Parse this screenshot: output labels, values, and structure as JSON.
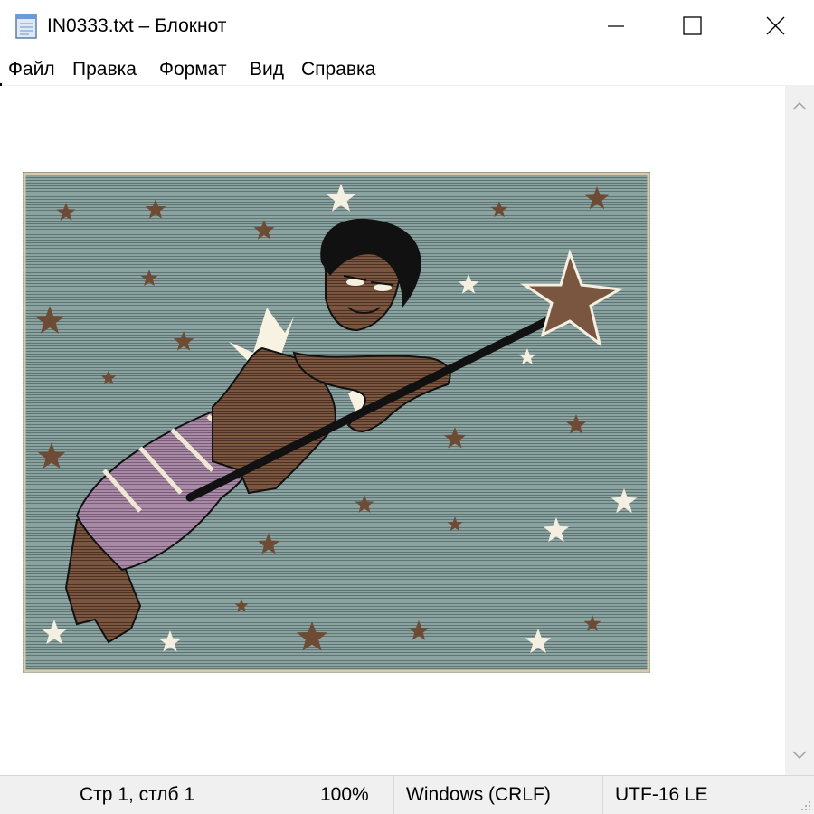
{
  "window": {
    "title": "IN0333.txt – Блокнот",
    "icon": "notepad-icon",
    "controls": [
      "minimize-icon",
      "maximize-icon",
      "close-icon"
    ]
  },
  "menu": {
    "items": [
      {
        "label": "Файл"
      },
      {
        "label": "Правка"
      },
      {
        "label": "Формат"
      },
      {
        "label": "Вид"
      },
      {
        "label": "Справка"
      }
    ]
  },
  "editor": {
    "content_description_icon": "ascii-art-image"
  },
  "statusbar": {
    "position": "Стр 1, стлб 1",
    "zoom": "100%",
    "line_ending": "Windows (CRLF)",
    "encoding": "UTF-16 LE"
  },
  "colors": {
    "background": "#7e9594",
    "skin": "#6e4b35",
    "hair": "#111111",
    "skirt": "#9a7a98",
    "stars_light": "#f4efe0",
    "stars_dark": "#6e4b35",
    "wand": "#111111"
  }
}
